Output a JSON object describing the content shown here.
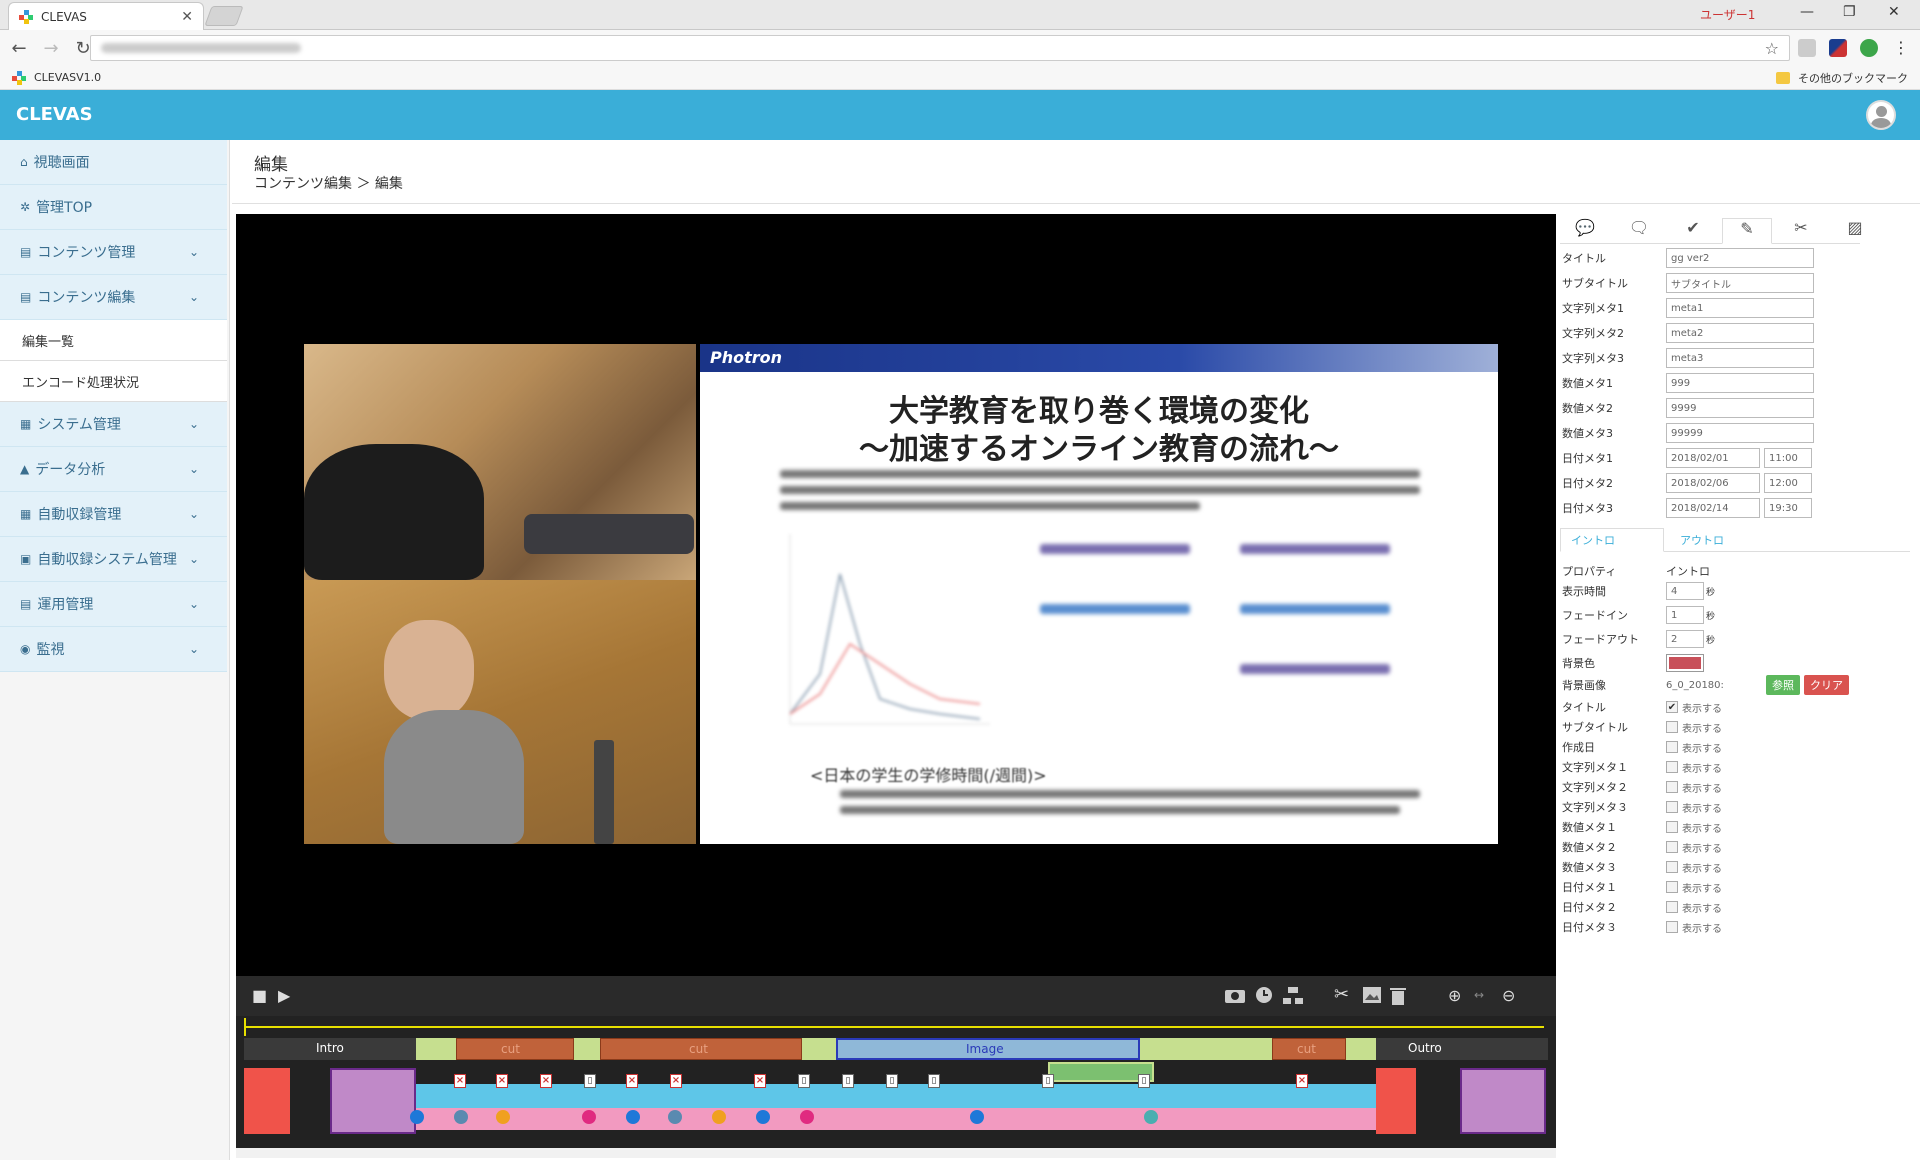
{
  "browser": {
    "tab_title": "CLEVAS",
    "tab_close": "✕",
    "user_label": "ユーザー1",
    "win_min": "—",
    "win_max": "❐",
    "win_close": "✕",
    "nav_back": "←",
    "nav_forward": "→",
    "nav_reload": "↻",
    "star": "☆",
    "menu": "⋮",
    "bookmark_left": "CLEVASV1.0",
    "bookmark_right": "その他のブックマーク"
  },
  "app": {
    "brand": "CLEVAS"
  },
  "sidebar": {
    "items": [
      {
        "label": "視聴画面",
        "icon": "home-icon",
        "glyph": "⌂"
      },
      {
        "label": "管理TOP",
        "icon": "gear-icon",
        "glyph": "✲"
      },
      {
        "label": "コンテンツ管理",
        "icon": "film-icon",
        "glyph": "▤",
        "chev": "⌄"
      },
      {
        "label": "コンテンツ編集",
        "icon": "film-icon",
        "glyph": "▤",
        "chev": "⌄"
      },
      {
        "label": "編集一覧"
      },
      {
        "label": "エンコード処理状況"
      },
      {
        "label": "システム管理",
        "icon": "server-icon",
        "glyph": "▦",
        "chev": "⌄"
      },
      {
        "label": "データ分析",
        "icon": "chart-icon",
        "glyph": "▲",
        "chev": "⌄"
      },
      {
        "label": "自動収録管理",
        "icon": "calendar-icon",
        "glyph": "▦",
        "chev": "⌄"
      },
      {
        "label": "自動収録システム管理",
        "icon": "file-icon",
        "glyph": "▣",
        "chev": "⌄"
      },
      {
        "label": "運用管理",
        "icon": "card-icon",
        "glyph": "▤",
        "chev": "⌄"
      },
      {
        "label": "監視",
        "icon": "eye-icon",
        "glyph": "◉",
        "chev": "⌄"
      }
    ]
  },
  "page": {
    "title": "編集",
    "breadcrumb": "コンテンツ編集 ＞ 編集"
  },
  "player": {
    "slide_brand": "Photron",
    "slide_title1": "大学教育を取り巻く環境の変化",
    "slide_title2": "～加速するオンライン教育の流れ～",
    "slide_caption": "<日本の学生の学修時間(/週間)>",
    "stop": "■",
    "play": "▶"
  },
  "timeline": {
    "intro": "Intro",
    "outro": "Outro",
    "cut1": "cut",
    "cut2": "cut",
    "cut3": "cut",
    "image": "Image"
  },
  "meta_form": {
    "fields": [
      {
        "label": "タイトル",
        "value": "gg ver2"
      },
      {
        "label": "サブタイトル",
        "value": "サブタイトル"
      },
      {
        "label": "文字列メタ1",
        "value": "meta1"
      },
      {
        "label": "文字列メタ2",
        "value": "meta2"
      },
      {
        "label": "文字列メタ3",
        "value": "meta3"
      },
      {
        "label": "数値メタ1",
        "value": "999"
      },
      {
        "label": "数値メタ2",
        "value": "9999"
      },
      {
        "label": "数値メタ3",
        "value": "99999"
      }
    ],
    "dates": [
      {
        "label": "日付メタ1",
        "date": "2018/02/01",
        "time": "11:00"
      },
      {
        "label": "日付メタ2",
        "date": "2018/02/06",
        "time": "12:00"
      },
      {
        "label": "日付メタ3",
        "date": "2018/02/14",
        "time": "19:30"
      }
    ]
  },
  "intro_tab": {
    "tab_intro": "イントロ",
    "tab_outro": "アウトロ",
    "property_label": "プロパティ",
    "property_value": "イントロ",
    "display_time_label": "表示時間",
    "display_time": "4",
    "fade_in_label": "フェードイン",
    "fade_in": "1",
    "fade_out_label": "フェードアウト",
    "fade_out": "2",
    "unit": "秒",
    "bg_color_label": "背景色",
    "bg_color": "#c8505a",
    "bg_image_label": "背景画像",
    "bg_image_value": "6_0_20180:",
    "ref_button": "参照",
    "clear_button": "クリア",
    "show_label": "表示する",
    "show_items": [
      {
        "label": "タイトル",
        "checked": true
      },
      {
        "label": "サブタイトル",
        "checked": false
      },
      {
        "label": "作成日",
        "checked": false
      },
      {
        "label": "文字列メタ１",
        "checked": false
      },
      {
        "label": "文字列メタ２",
        "checked": false
      },
      {
        "label": "文字列メタ３",
        "checked": false
      },
      {
        "label": "数値メタ１",
        "checked": false
      },
      {
        "label": "数値メタ２",
        "checked": false
      },
      {
        "label": "数値メタ３",
        "checked": false
      },
      {
        "label": "日付メタ１",
        "checked": false
      },
      {
        "label": "日付メタ２",
        "checked": false
      },
      {
        "label": "日付メタ３",
        "checked": false
      }
    ]
  }
}
